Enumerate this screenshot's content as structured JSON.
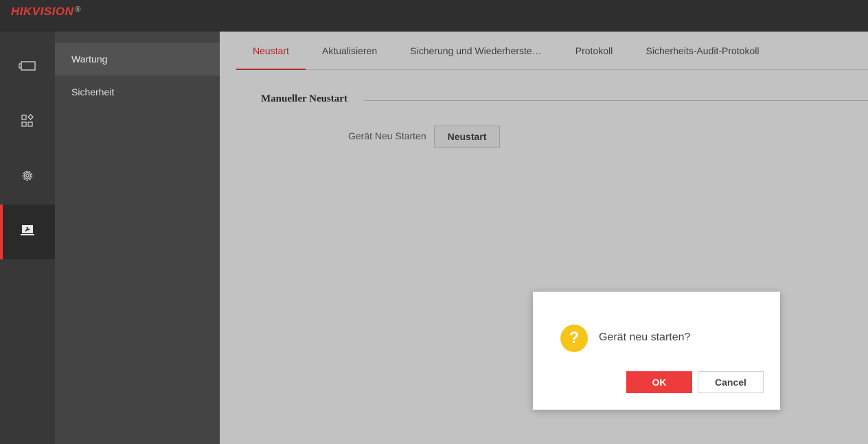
{
  "header": {
    "brand": "HIKVISION",
    "brand_mark": "®",
    "brand_color": "#e03a3a"
  },
  "icon_sidebar": {
    "items": [
      {
        "icon": "live-view-icon",
        "active": false
      },
      {
        "icon": "apps-grid-icon",
        "active": false
      },
      {
        "icon": "gear-icon",
        "active": false
      },
      {
        "icon": "maintenance-monitor-icon",
        "active": true
      }
    ]
  },
  "subnav": {
    "items": [
      {
        "label": "Wartung",
        "active": true
      },
      {
        "label": "Sicherheit",
        "active": false
      }
    ]
  },
  "tabs": [
    {
      "label": "Neustart",
      "active": true
    },
    {
      "label": "Aktualisieren",
      "active": false
    },
    {
      "label": "Sicherung und Wiederherste…",
      "active": false
    },
    {
      "label": "Protokoll",
      "active": false
    },
    {
      "label": "Sicherheits-Audit-Protokoll",
      "active": false
    }
  ],
  "main": {
    "section_title": "Manueller Neustart",
    "field_label": "Gerät Neu Starten",
    "reboot_button": "Neustart"
  },
  "dialog": {
    "icon": "question-icon",
    "icon_color": "#f5c518",
    "message": "Gerät neu starten?",
    "ok_label": "OK",
    "cancel_label": "Cancel",
    "ok_color": "#ee3b3b"
  }
}
